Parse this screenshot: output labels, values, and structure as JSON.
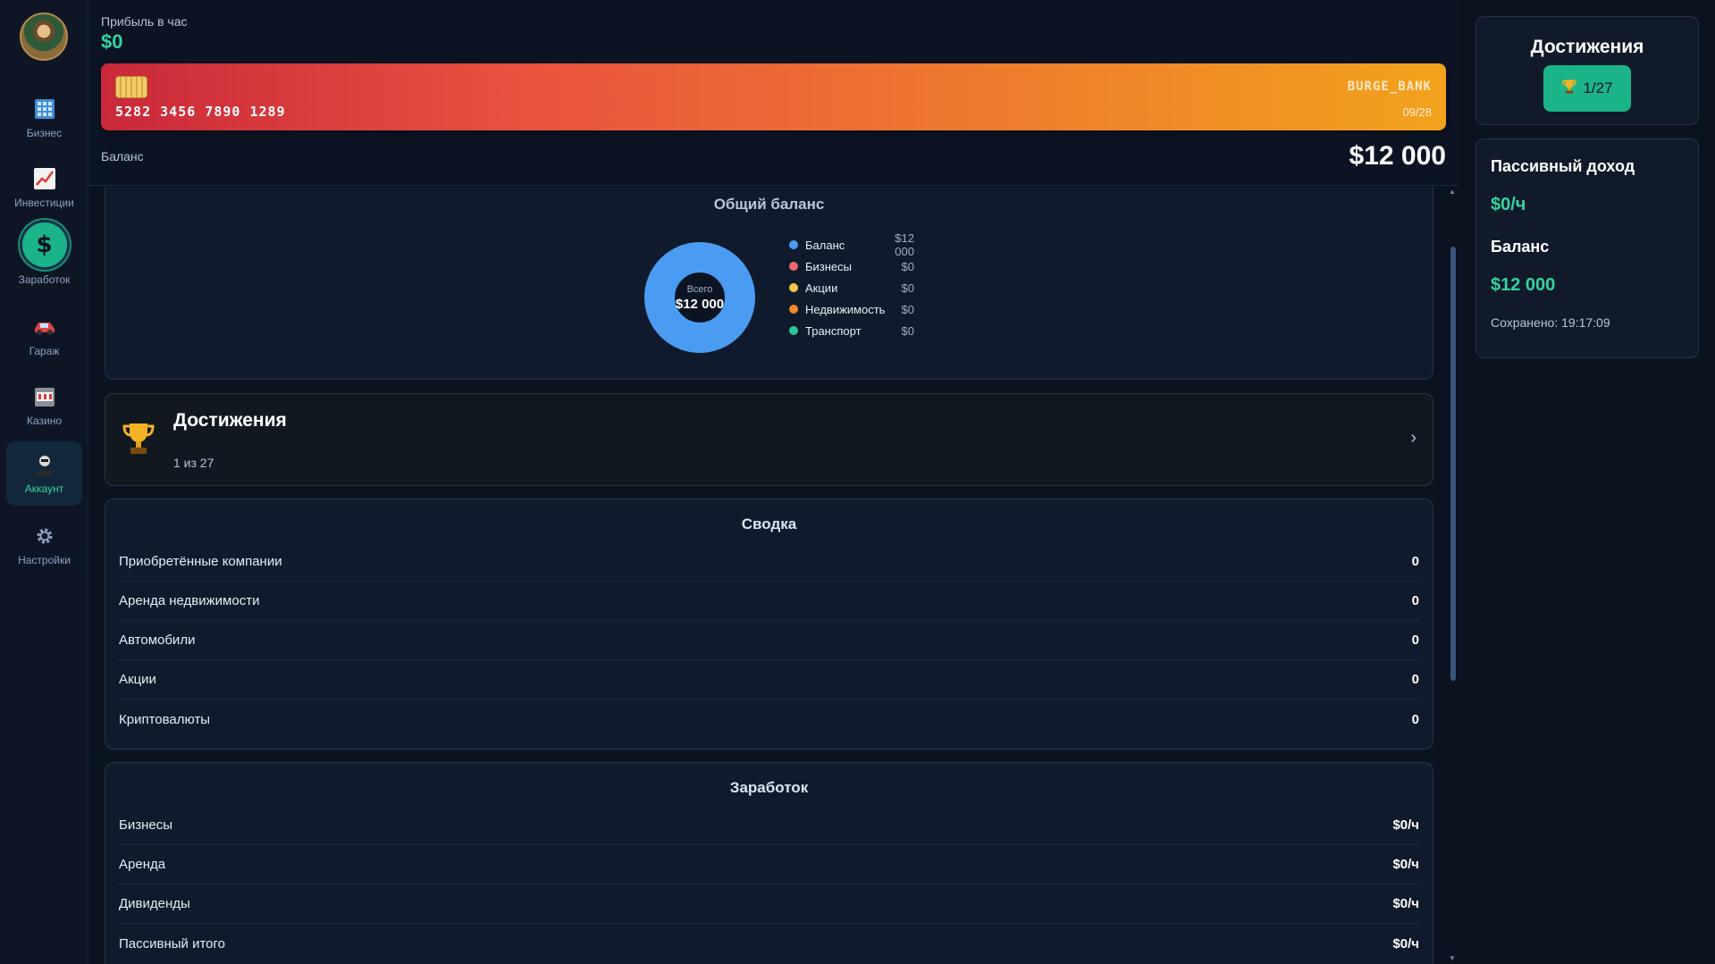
{
  "sidebar": {
    "items": [
      {
        "label": "Бизнес",
        "icon": "building-icon"
      },
      {
        "label": "Инвестиции",
        "icon": "chart-up-icon"
      },
      {
        "label": "Заработок",
        "icon": "dollar-icon"
      },
      {
        "label": "Гараж",
        "icon": "car-icon"
      },
      {
        "label": "Казино",
        "icon": "slot-machine-icon"
      },
      {
        "label": "Аккаунт",
        "icon": "user-icon"
      },
      {
        "label": "Настройки",
        "icon": "gear-icon"
      }
    ],
    "active": "Аккаунт",
    "earn_symbol": "$"
  },
  "header": {
    "profit_label": "Прибыль в час",
    "profit_value": "$0",
    "card": {
      "number": "5282 3456 7890 1289",
      "bank": "BURGE_BANK",
      "expiry": "09/28"
    },
    "balance_label": "Баланс",
    "balance_value": "$12 000"
  },
  "overview": {
    "title": "Общий баланс",
    "center_label": "Всего",
    "center_value": "$12 000",
    "legend": [
      {
        "name": "Баланс",
        "value": "$12 000",
        "color": "#4a9cf2"
      },
      {
        "name": "Бизнесы",
        "value": "$0",
        "color": "#f06a6a"
      },
      {
        "name": "Акции",
        "value": "$0",
        "color": "#f3c94a"
      },
      {
        "name": "Недвижимость",
        "value": "$0",
        "color": "#f08a2a"
      },
      {
        "name": "Транспорт",
        "value": "$0",
        "color": "#2fc59a"
      }
    ]
  },
  "chart_data": {
    "type": "pie",
    "categories": [
      "Баланс",
      "Бизнесы",
      "Акции",
      "Недвижимость",
      "Транспорт"
    ],
    "values": [
      12000,
      0,
      0,
      0,
      0
    ],
    "title": "Общий баланс"
  },
  "achievements_card": {
    "title": "Достижения",
    "subtitle": "1 из 27",
    "arrow": "›"
  },
  "summary": {
    "title": "Сводка",
    "rows": [
      {
        "label": "Приобретённые компании",
        "value": "0"
      },
      {
        "label": "Аренда недвижимости",
        "value": "0"
      },
      {
        "label": "Автомобили",
        "value": "0"
      },
      {
        "label": "Акции",
        "value": "0"
      },
      {
        "label": "Криптовалюты",
        "value": "0"
      }
    ]
  },
  "earnings": {
    "title": "Заработок",
    "rows": [
      {
        "label": "Бизнесы",
        "value": "$0/ч"
      },
      {
        "label": "Аренда",
        "value": "$0/ч"
      },
      {
        "label": "Дивиденды",
        "value": "$0/ч"
      },
      {
        "label": "Пассивный итого",
        "value": "$0/ч"
      }
    ]
  },
  "right": {
    "achievements_title": "Достижения",
    "achievements_badge": "1/27",
    "passive_label": "Пассивный доход",
    "passive_value": "$0/ч",
    "balance_label": "Баланс",
    "balance_value": "$12 000",
    "saved": "Сохранено: 19:17:09"
  }
}
